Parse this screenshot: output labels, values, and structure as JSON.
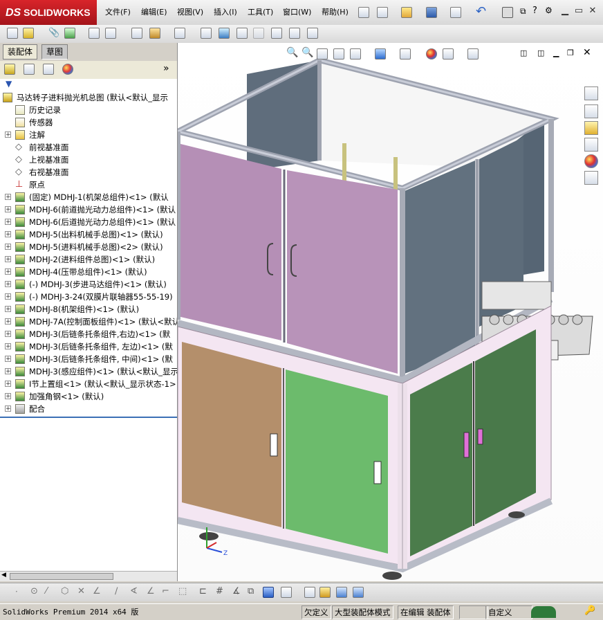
{
  "app": {
    "brand": "SOLIDWORKS",
    "brand_prefix": "DS"
  },
  "menu": [
    "文件(F)",
    "编辑(E)",
    "视图(V)",
    "插入(I)",
    "工具(T)",
    "窗口(W)",
    "帮助(H)"
  ],
  "left_panel": {
    "tabs": [
      "装配体",
      "草图"
    ],
    "expand_symbol": "»",
    "tree": [
      {
        "label": "马达转子进料抛光机总图  (默认<默认_显示",
        "icon": "assembly-icon",
        "expand": false,
        "indent": 0
      },
      {
        "label": "历史记录",
        "icon": "history-icon",
        "expand": false,
        "indent": 1
      },
      {
        "label": "传感器",
        "icon": "sensor-icon",
        "expand": false,
        "indent": 1
      },
      {
        "label": "注解",
        "icon": "annotation-icon",
        "expand": true,
        "indent": 1
      },
      {
        "label": "前视基准面",
        "icon": "plane-icon",
        "expand": false,
        "indent": 1
      },
      {
        "label": "上视基准面",
        "icon": "plane-icon",
        "expand": false,
        "indent": 1
      },
      {
        "label": "右视基准面",
        "icon": "plane-icon",
        "expand": false,
        "indent": 1
      },
      {
        "label": "原点",
        "icon": "origin-icon",
        "expand": false,
        "indent": 1
      },
      {
        "label": "(固定) MDHJ-1(机架总组件)<1> (默认",
        "icon": "subassembly-icon",
        "expand": true,
        "indent": 1
      },
      {
        "label": "MDHJ-6(前道抛光动力总组件)<1> (默认",
        "icon": "subassembly-icon",
        "expand": true,
        "indent": 1
      },
      {
        "label": "MDHJ-6(后道抛光动力总组件)<1> (默认",
        "icon": "subassembly-icon",
        "expand": true,
        "indent": 1
      },
      {
        "label": "MDHJ-5(出料机械手总图)<1> (默认)",
        "icon": "subassembly-icon",
        "expand": true,
        "indent": 1
      },
      {
        "label": "MDHJ-5(进料机械手总图)<2> (默认)",
        "icon": "subassembly-icon",
        "expand": true,
        "indent": 1
      },
      {
        "label": "MDHJ-2(进料组件总图)<1> (默认)",
        "icon": "subassembly-icon",
        "expand": true,
        "indent": 1
      },
      {
        "label": "MDHJ-4(压带总组件)<1> (默认)",
        "icon": "subassembly-icon",
        "expand": true,
        "indent": 1
      },
      {
        "label": "(-) MDHJ-3(步进马达组件)<1> (默认)",
        "icon": "subassembly-icon",
        "expand": true,
        "indent": 1
      },
      {
        "label": "(-) MDHJ-3-24(双膜片联轴器55-55-19)",
        "icon": "subassembly-icon",
        "expand": true,
        "indent": 1
      },
      {
        "label": "MDHJ-8(机架组件)<1> (默认)",
        "icon": "subassembly-icon",
        "expand": true,
        "indent": 1
      },
      {
        "label": "MDHJ-7A(控制面板组件)<1> (默认<默认",
        "icon": "subassembly-icon",
        "expand": true,
        "indent": 1
      },
      {
        "label": "MDHJ-3(后链条托条组件,右边)<1> (默",
        "icon": "subassembly-icon",
        "expand": true,
        "indent": 1
      },
      {
        "label": "MDHJ-3(后链条托条组件, 左边)<1> (默",
        "icon": "subassembly-icon",
        "expand": true,
        "indent": 1
      },
      {
        "label": "MDHJ-3(后链条托条组件, 中间)<1> (默",
        "icon": "subassembly-icon",
        "expand": true,
        "indent": 1
      },
      {
        "label": "MDHJ-3(感应组件)<1> (默认<默认_显示",
        "icon": "subassembly-icon",
        "expand": true,
        "indent": 1
      },
      {
        "label": "I节上置组<1> (默认<默认_显示状态-1>",
        "icon": "subassembly-icon",
        "expand": true,
        "indent": 1
      },
      {
        "label": "加强角钢<1> (默认)",
        "icon": "subassembly-icon",
        "expand": true,
        "indent": 1
      },
      {
        "label": "配合",
        "icon": "mates-icon",
        "expand": true,
        "indent": 1
      }
    ]
  },
  "status_bar": {
    "product": "SolidWorks Premium 2014 x64 版",
    "cells": [
      "欠定义",
      "大型装配体模式",
      "在编辑 装配体"
    ],
    "units": "自定义"
  },
  "colors": {
    "frame": "#b8b8c4",
    "panel_pink": "#b890b8",
    "panel_slate": "#5e6f7f",
    "door_brown": "#b4906c",
    "door_green_light": "#6cbc6c",
    "door_green_dark": "#4a7a4a",
    "base_pink": "#f6e8f4"
  }
}
